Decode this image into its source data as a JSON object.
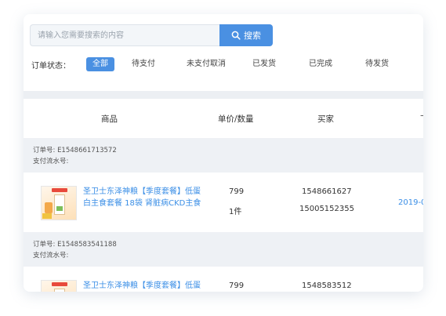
{
  "search": {
    "placeholder": "请输入您需要搜索的内容",
    "button_label": "搜索"
  },
  "filters": {
    "label": "订单状态：",
    "tabs": [
      {
        "label": "全部",
        "active": true
      },
      {
        "label": "待支付",
        "active": false
      },
      {
        "label": "未支付取消",
        "active": false
      },
      {
        "label": "已发货",
        "active": false
      },
      {
        "label": "已完成",
        "active": false
      },
      {
        "label": "待发货",
        "active": false
      }
    ]
  },
  "table": {
    "headers": {
      "product": "商品",
      "price_qty": "单价/数量",
      "buyer": "买家",
      "extra": "下"
    }
  },
  "orders": [
    {
      "order_no": "订单号: E1548661713572",
      "payment_no": "支付流水号:",
      "product_name": "圣卫士东泽神粮【季度套餐】低蛋白主食套餐 18袋 肾脏病CKD主食",
      "price": "799",
      "qty": "1件",
      "buyer_id": "1548661627",
      "buyer_phone": "15005152355",
      "date": "2019-0"
    },
    {
      "order_no": "订单号: E1548583541188",
      "payment_no": "支付流水号:",
      "product_name": "圣卫士东泽神粮【季度套餐】低蛋",
      "price": "799",
      "buyer_id": "1548583512"
    }
  ],
  "colors": {
    "accent": "#4a90e2",
    "link": "#3a8ee6",
    "band": "#eef1f5"
  },
  "icons": {
    "search_button": "search-icon"
  }
}
